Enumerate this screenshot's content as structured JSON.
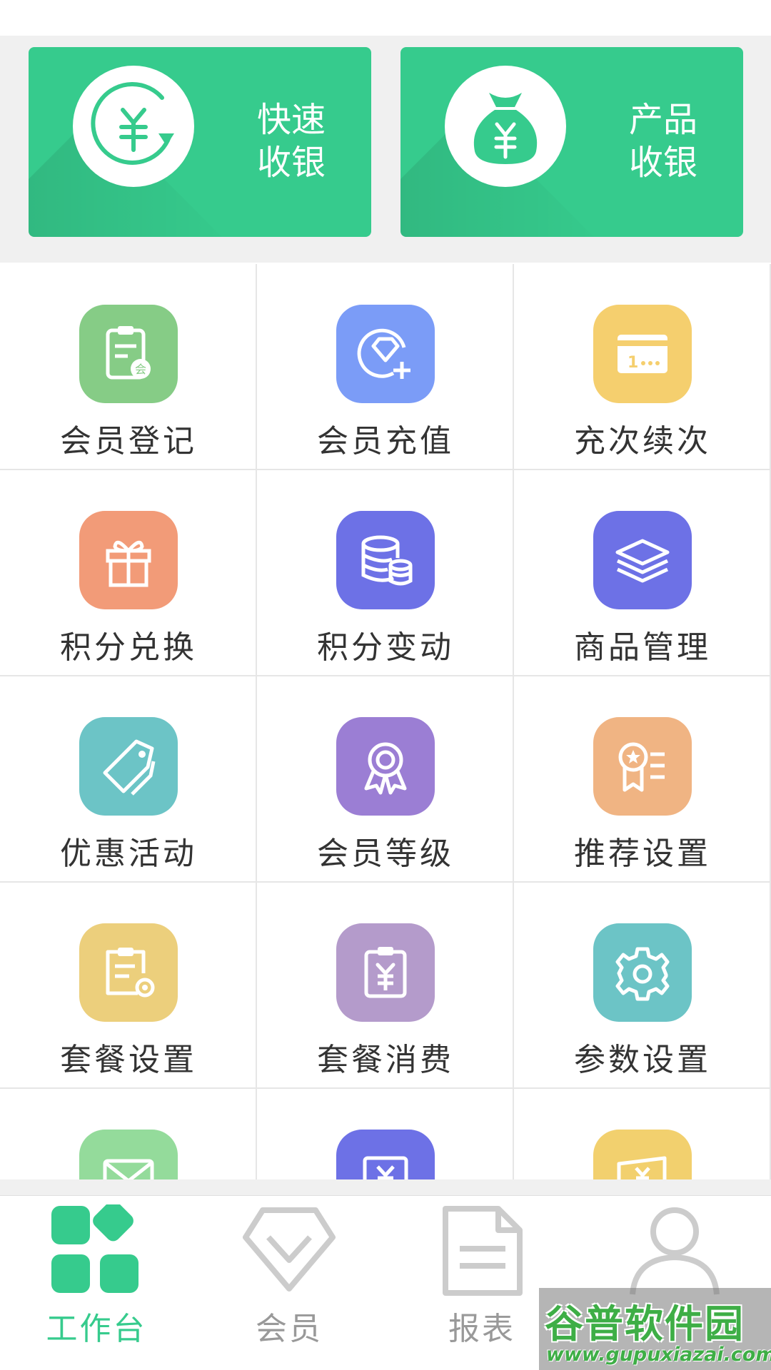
{
  "quick_actions": [
    {
      "line1": "快速",
      "line2": "收银",
      "icon": "yuan-cycle-icon"
    },
    {
      "line1": "产品",
      "line2": "收银",
      "icon": "money-bag-icon"
    }
  ],
  "grid_items": [
    {
      "label": "会员登记",
      "icon": "clipboard-member-icon",
      "color": "#86cc86"
    },
    {
      "label": "会员充值",
      "icon": "diamond-add-icon",
      "color": "#7b9cf7"
    },
    {
      "label": "充次续次",
      "icon": "card-icon",
      "color": "#f5cf6e"
    },
    {
      "label": "积分兑换",
      "icon": "gift-icon",
      "color": "#f29b78"
    },
    {
      "label": "积分变动",
      "icon": "coins-stack-icon",
      "color": "#6d71e6"
    },
    {
      "label": "商品管理",
      "icon": "layers-icon",
      "color": "#6d71e6"
    },
    {
      "label": "优惠活动",
      "icon": "tag-icon",
      "color": "#6cc4c6"
    },
    {
      "label": "会员等级",
      "icon": "award-icon",
      "color": "#9b7ed4"
    },
    {
      "label": "推荐设置",
      "icon": "certificate-icon",
      "color": "#f0b483"
    },
    {
      "label": "套餐设置",
      "icon": "package-settings-icon",
      "color": "#eccf7c"
    },
    {
      "label": "套餐消费",
      "icon": "package-consume-icon",
      "color": "#b49bcb"
    },
    {
      "label": "参数设置",
      "icon": "gear-icon",
      "color": "#6cc4c6"
    },
    {
      "label": "",
      "icon": "mail-icon",
      "color": "#94db9b"
    },
    {
      "label": "",
      "icon": "yuan-receipt-icon",
      "color": "#6d71e6"
    },
    {
      "label": "",
      "icon": "yuan-card-icon",
      "color": "#f2d06e"
    }
  ],
  "tabs": [
    {
      "label": "工作台",
      "icon": "dashboard-icon",
      "active": true
    },
    {
      "label": "会员",
      "icon": "diamond-icon",
      "active": false
    },
    {
      "label": "报表",
      "icon": "report-icon",
      "active": false
    },
    {
      "label": "",
      "icon": "person-icon",
      "active": false
    }
  ],
  "colors": {
    "accent": "#36cb8d",
    "tab_inactive": "#999999",
    "text": "#333333"
  },
  "watermark": {
    "title": "谷普软件园",
    "url": "www.gupuxiazai.com"
  }
}
